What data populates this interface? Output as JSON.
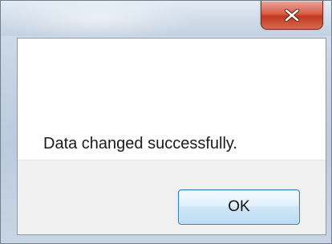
{
  "dialog": {
    "close_icon": "close-icon",
    "message": "Data changed successfully.",
    "ok_label": "OK"
  },
  "colors": {
    "close_button": "#c7452d",
    "ok_button_border": "#3c7fb1"
  }
}
